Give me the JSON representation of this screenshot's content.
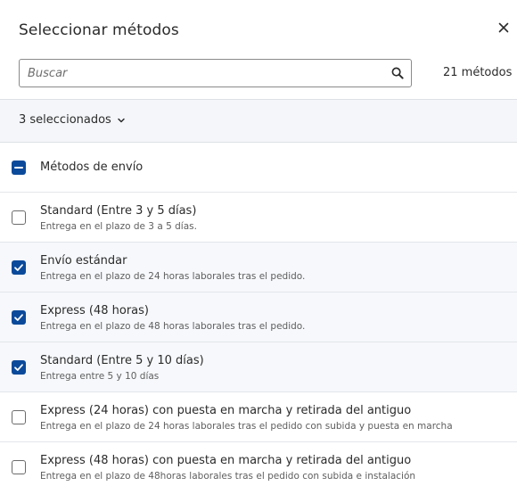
{
  "dialog": {
    "title": "Seleccionar métodos",
    "close_icon": "close-icon"
  },
  "search": {
    "value": "",
    "placeholder": "Buscar",
    "icon": "search-icon"
  },
  "count_label": "21 métodos",
  "selection": {
    "label": "3 seleccionados",
    "icon": "chevron-down-icon"
  },
  "group": {
    "label": "Métodos de envío",
    "state": "indeterminate"
  },
  "items": [
    {
      "title": "Standard (Entre 3 y 5 días)",
      "description": "Entrega en el plazo de 3 a 5 días.",
      "checked": false
    },
    {
      "title": "Envío estándar",
      "description": "Entrega en el plazo de 24 horas laborales tras el pedido.",
      "checked": true
    },
    {
      "title": "Express (48 horas)",
      "description": "Entrega en el plazo de 48 horas laborales tras el pedido.",
      "checked": true
    },
    {
      "title": "Standard (Entre 5 y 10 días)",
      "description": "Entrega entre 5 y 10 días",
      "checked": true
    },
    {
      "title": "Express (24 horas) con puesta en marcha y retirada del antiguo",
      "description": "Entrega en el plazo de 24 horas laborales tras el pedido con subida y puesta en marcha",
      "checked": false
    },
    {
      "title": "Express (48 horas) con puesta en marcha y retirada del antiguo",
      "description": "Entrega en el plazo de 48horas laborales tras el pedido con subida e instalación",
      "checked": false
    }
  ],
  "colors": {
    "accent": "#0b4a9a",
    "selected_row_bg": "#f6f8fb",
    "bar_bg": "#f4f6f9"
  }
}
